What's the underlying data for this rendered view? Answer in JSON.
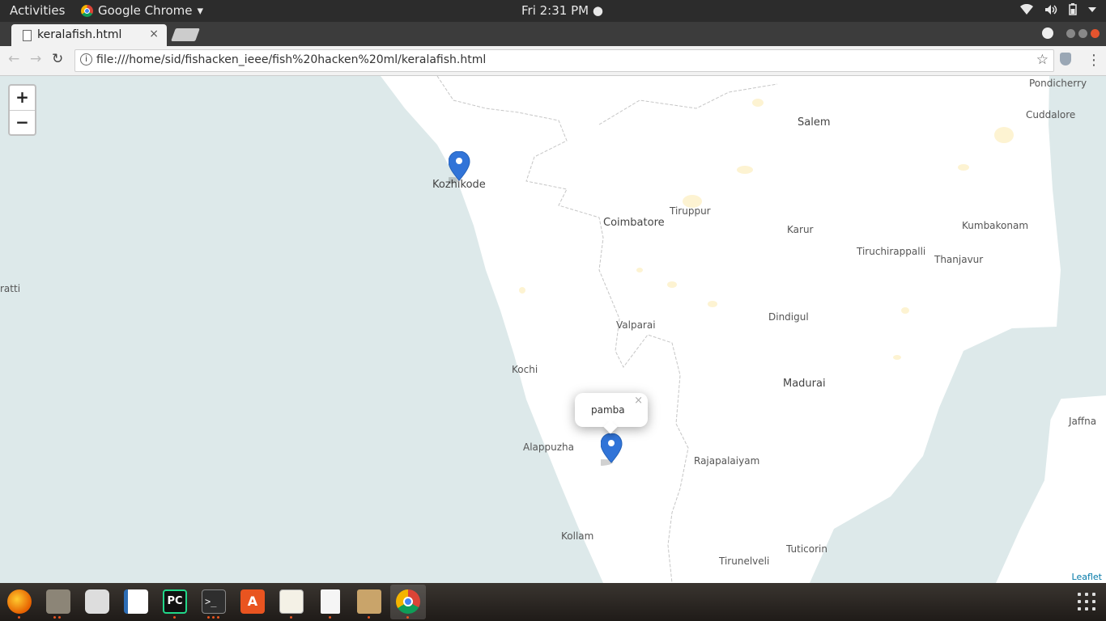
{
  "topbar": {
    "activities": "Activities",
    "app_name": "Google Chrome",
    "app_arrow": "▾",
    "clock": "Fri  2:31 PM ●",
    "tray_icons": [
      "wifi-icon",
      "volume-icon",
      "battery-icon",
      "menu-arrow-icon"
    ]
  },
  "browser": {
    "tab_title": "keralafish.html",
    "tab_close": "×",
    "url": "file:///home/sid/fishacken_ieee/fish%20hacken%20ml/keralafish.html",
    "back": "←",
    "forward": "→",
    "reload": "↻",
    "info": "i",
    "star": "☆",
    "menu": "⋮"
  },
  "map": {
    "zoom_in": "+",
    "zoom_out": "−",
    "attribution": "Leaflet",
    "popup_text": "pamba",
    "popup_close": "×",
    "water_color": "#dde9ea",
    "land_color": "#ffffff",
    "marker_color": "#3174d8",
    "labels": {
      "pondicherry": "Pondicherry",
      "cuddalore": "Cuddalore",
      "salem": "Salem",
      "kozhikode": "Kozhikode",
      "tiruppur": "Tiruppur",
      "coimbatore": "Coimbatore",
      "karur": "Karur",
      "kumbakonam": "Kumbakonam",
      "tiruchirappalli": "Tiruchirappalli",
      "thanjavur": "Thanjavur",
      "kavaratti": "ratti",
      "valparai": "Valparai",
      "dindigul": "Dindigul",
      "kochi": "Kochi",
      "madurai": "Madurai",
      "jaffna": "Jaffna",
      "alappuzha": "Alappuzha",
      "rajapalaiyam": "Rajapalaiyam",
      "kollam": "Kollam",
      "tuticorin": "Tuticorin",
      "tirunelveli": "Tirunelveli"
    }
  },
  "dock": {
    "apps": [
      "firefox-icon",
      "files-icon",
      "rhythmbox-icon",
      "writer-icon",
      "pycharm-icon",
      "terminal-icon",
      "software-center-icon",
      "text-editor-icon",
      "document-icon",
      "archive-manager-icon",
      "chrome-icon"
    ],
    "pycharm_label": "PC",
    "terminal_label": ">_",
    "software_label": "A"
  }
}
